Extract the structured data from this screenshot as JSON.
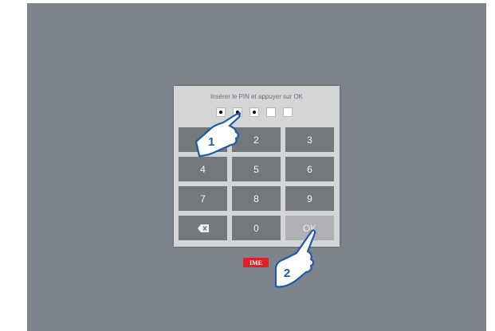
{
  "pin_prompt": "Insérer le PIN et appuyer sur OK",
  "pin_digits": [
    {
      "filled": true
    },
    {
      "filled": true
    },
    {
      "filled": true
    },
    {
      "filled": false
    },
    {
      "filled": false
    }
  ],
  "keys": {
    "k1": "1",
    "k2": "2",
    "k3": "3",
    "k4": "4",
    "k5": "5",
    "k6": "6",
    "k7": "7",
    "k8": "8",
    "k9": "9",
    "k0": "0",
    "ok": "OK"
  },
  "backspace_icon": "backspace-icon",
  "logo_text": "IME",
  "annotations": {
    "step1": "1",
    "step2": "2"
  },
  "colors": {
    "background": "#7e848c",
    "panel": "#d3d5d7",
    "key": "#75787b",
    "ok_key": "#aeb0b3",
    "logo": "#d8222a",
    "annotation_blue": "#1e5aa8"
  }
}
